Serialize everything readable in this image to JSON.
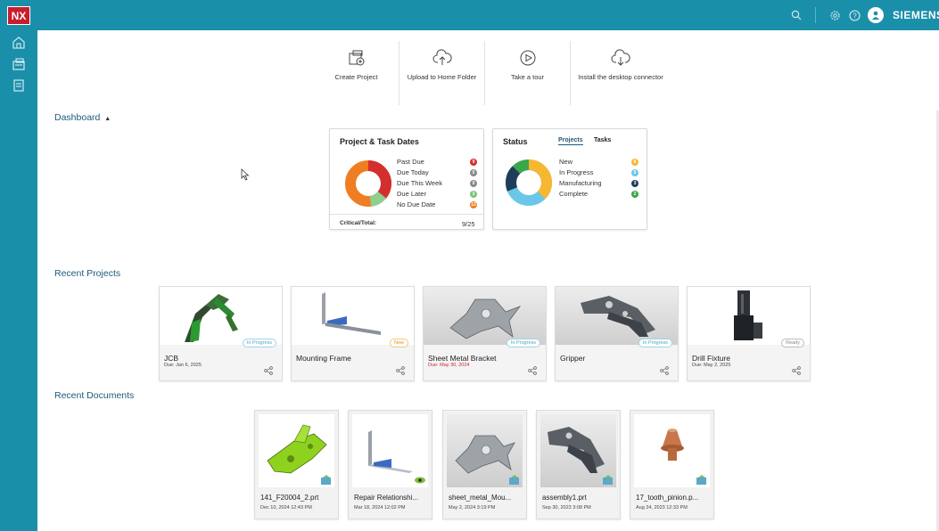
{
  "app": {
    "logo": "NX",
    "brand": "SIEMENS"
  },
  "colors": {
    "accent": "#1a8faa",
    "logo_red": "#c91d2e",
    "past_due": "#d32f2f",
    "orange": "#ef7d22",
    "green": "#7cc47c",
    "yellow": "#f6b731",
    "light_blue": "#6bc7ea",
    "navy": "#1f3d5a",
    "complete_green": "#3aa64a"
  },
  "topbar": {
    "icons": [
      "search-icon",
      "settings-icon",
      "help-icon",
      "user-icon"
    ]
  },
  "sidebar": {
    "icons": [
      "home-icon",
      "projects-icon",
      "documents-icon"
    ]
  },
  "actions": [
    {
      "label": "Create Project",
      "icon": "create-project-icon"
    },
    {
      "label": "Upload to Home Folder",
      "icon": "cloud-upload-icon"
    },
    {
      "label": "Take a tour",
      "icon": "play-icon"
    },
    {
      "label": "Install the desktop connector",
      "icon": "cloud-download-icon"
    }
  ],
  "dashboard": {
    "title": "Dashboard",
    "dates_card": {
      "title": "Project & Task Dates",
      "legend": [
        {
          "label": "Past Due",
          "count": "9",
          "color": "#d32f2f"
        },
        {
          "label": "Due Today",
          "count": "0",
          "color": "#8a8a8a"
        },
        {
          "label": "Due This Week",
          "count": "0",
          "color": "#8a8a8a"
        },
        {
          "label": "Due Later",
          "count": "3",
          "color": "#7cc47c"
        },
        {
          "label": "No Due Date",
          "count": "13",
          "color": "#ef7d22"
        }
      ],
      "footer_label": "Critical/Total:",
      "footer_value": "9/25"
    },
    "status_card": {
      "title": "Status",
      "tabs": [
        "Projects",
        "Tasks"
      ],
      "active_tab": "Projects",
      "legend": [
        {
          "label": "New",
          "count": "6",
          "color": "#f6b731"
        },
        {
          "label": "In Progress",
          "count": "5",
          "color": "#6bc7ea"
        },
        {
          "label": "Manufacturing",
          "count": "3",
          "color": "#1f3d5a"
        },
        {
          "label": "Complete",
          "count": "2",
          "color": "#3aa64a"
        }
      ]
    }
  },
  "recent_projects": {
    "title": "Recent Projects",
    "items": [
      {
        "name": "JCB",
        "due": "Due: Jan 6, 2025",
        "status": "In Progress",
        "overdue": false
      },
      {
        "name": "Mounting Frame",
        "due": "",
        "status": "New",
        "overdue": false
      },
      {
        "name": "Sheet Metal Bracket",
        "due": "Due: May 30, 2024",
        "status": "In Progress",
        "overdue": true
      },
      {
        "name": "Gripper",
        "due": "",
        "status": "In Progress",
        "overdue": false
      },
      {
        "name": "Drill Fixture",
        "due": "Due: May 2, 2025",
        "status": "Ready",
        "overdue": false
      }
    ]
  },
  "recent_documents": {
    "title": "Recent Documents",
    "items": [
      {
        "name": "141_F20004_2.prt",
        "date": "Dec 10, 2024 12:43 PM"
      },
      {
        "name": "Repair Relationshi...",
        "date": "Mar 18, 2024 12:02 PM"
      },
      {
        "name": "sheet_metal_Mou...",
        "date": "May 2, 2024 3:19 PM"
      },
      {
        "name": "assembly1.prt",
        "date": "Sep 30, 2023 3:08 PM"
      },
      {
        "name": "17_tooth_pinion.p...",
        "date": "Aug 24, 2023 12:33 PM"
      }
    ]
  }
}
